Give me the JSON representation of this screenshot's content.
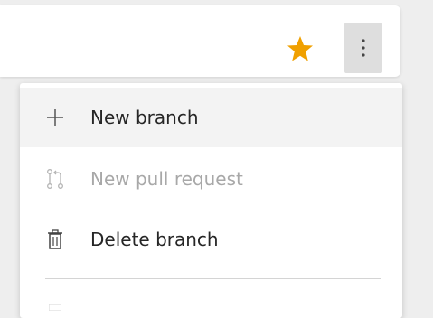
{
  "toolbar": {
    "star_color": "#f0a000",
    "star_icon": "star-icon",
    "more_icon": "more-vertical-icon"
  },
  "menu": {
    "items": [
      {
        "label": "New branch",
        "icon": "plus-icon",
        "enabled": true,
        "hovered": true
      },
      {
        "label": "New pull request",
        "icon": "pull-request-icon",
        "enabled": false
      },
      {
        "label": "Delete branch",
        "icon": "trash-icon",
        "enabled": true
      }
    ]
  }
}
